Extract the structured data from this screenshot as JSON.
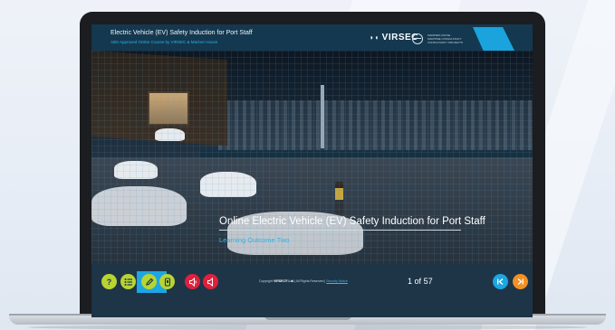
{
  "header": {
    "title": "Electric Vehicle (EV) Safety Induction for Port Staff",
    "subtitle": "ABS Approved Online Course by VIRSEC & Mariner House",
    "logo_text": "VIRSEC",
    "partner_lines": [
      "MARINER HOUSE",
      "MARITIME CONSULTANCY",
      "CONSULTANCY PROJECTS"
    ]
  },
  "slide": {
    "title": "Online Electric Vehicle (EV) Safety Induction for Port Staff",
    "subtitle": "Learning Outcome Two"
  },
  "footer": {
    "help_glyph": "?",
    "copyright_prefix": "Copyright",
    "copyright_brand": "VIRSEC® Ltd",
    "copyright_suffix": "| All Rights Reserved |",
    "security_link": "Security Notice",
    "page_current": "1",
    "page_of": "of",
    "page_total": "57"
  },
  "colors": {
    "header_bg": "#14384f",
    "accent_blue": "#1ca6e2",
    "lime": "#b8d432",
    "red": "#e0203c",
    "orange": "#f29023"
  }
}
